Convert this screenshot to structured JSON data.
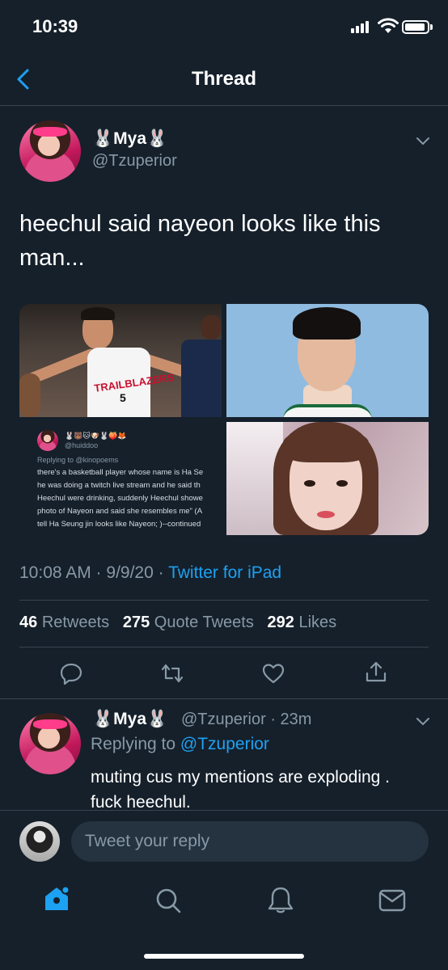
{
  "status": {
    "time": "10:39"
  },
  "nav": {
    "title": "Thread"
  },
  "tweet": {
    "name": "Mya",
    "emoji": "🐰",
    "handle": "@Tzuperior",
    "text": "heechul said nayeon looks like this man...",
    "date_time": "10:08 AM · 9/9/20 · ",
    "source": "Twitter for iPad",
    "stats": {
      "retweets_count": "46",
      "retweets_label": "Retweets",
      "quotes_count": "275",
      "quotes_label": "Quote Tweets",
      "likes_count": "292",
      "likes_label": "Likes"
    },
    "media_tweet": {
      "handle": "@huiddoo",
      "replying": "Replying to @kinopoems",
      "lines": [
        "there's a basketball player whose name is Ha Se",
        "he was doing a twitch live stream and he said th",
        "Heechul were drinking, suddenly Heechul showe",
        "photo of Nayeon and said she resembles me\" (A",
        "tell Ha Seung jin looks like Nayeon; )--continued"
      ],
      "jersey_text": "TRAILBLAZERS",
      "jersey_number": "5"
    }
  },
  "reply": {
    "name": "Mya",
    "emoji": "🐰",
    "handle_time": "@Tzuperior · 23m",
    "replying_prefix": "Replying to ",
    "replying_handle": "@Tzuperior",
    "text": "muting cus my mentions are exploding . fuck heechul."
  },
  "composer": {
    "placeholder": "Tweet your reply"
  },
  "tabs": [
    "home-icon",
    "search-icon",
    "notifications-icon",
    "messages-icon"
  ],
  "colors": {
    "background": "#15202b",
    "accent": "#1da1f2",
    "muted": "#8899a6",
    "divider": "#38444d"
  }
}
